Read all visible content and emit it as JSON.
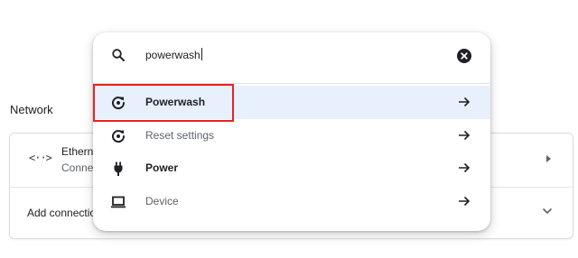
{
  "network": {
    "section_title": "Network",
    "ethernet_name": "Ethern",
    "ethernet_status": "Conne",
    "add_connection_label": "Add connectio"
  },
  "search": {
    "query": "powerwash",
    "results": [
      {
        "label": "Powerwash",
        "icon": "powerwash-icon",
        "bold": true,
        "selected": true
      },
      {
        "label": "Reset settings",
        "icon": "reset-icon",
        "bold": false,
        "selected": false
      },
      {
        "label": "Power",
        "icon": "plug-icon",
        "bold": true,
        "selected": false
      },
      {
        "label": "Device",
        "icon": "laptop-icon",
        "bold": false,
        "selected": false
      }
    ]
  },
  "colors": {
    "selected_bg": "#e8f0fe",
    "highlight_border": "#e0242a"
  }
}
